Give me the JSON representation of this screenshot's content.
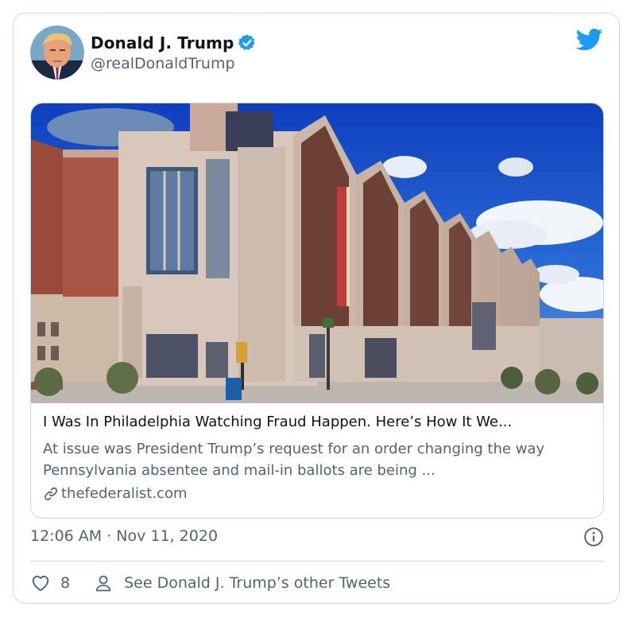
{
  "tweet": {
    "author": {
      "display_name": "Donald J. Trump",
      "handle": "@realDonaldTrump",
      "verified": true,
      "avatar_icon": "avatar-photo"
    },
    "brand": {
      "icon": "twitter-bird-icon",
      "color": "#1d9bf0"
    },
    "card": {
      "image_icon": "convention-center-photo",
      "title": "I Was In Philadelphia Watching Fraud Happen. Here’s How It We...",
      "description": "At issue was President Trump’s request for an order changing the way Pennsylvania absentee and mail-in ballots are being ...",
      "domain": "thefederalist.com",
      "domain_icon": "link-icon"
    },
    "timestamp": "12:06 AM · Nov 11, 2020",
    "info_icon": "info-icon",
    "actions": {
      "like_count": "8",
      "like_icon": "heart-icon",
      "profile_icon": "user-icon",
      "profile_link": "See Donald J. Trump’s other Tweets"
    },
    "colors": {
      "text_primary": "#0f1419",
      "text_secondary": "#536471",
      "border": "#cfd9de",
      "verified_badge": "#1d9bf0"
    }
  }
}
